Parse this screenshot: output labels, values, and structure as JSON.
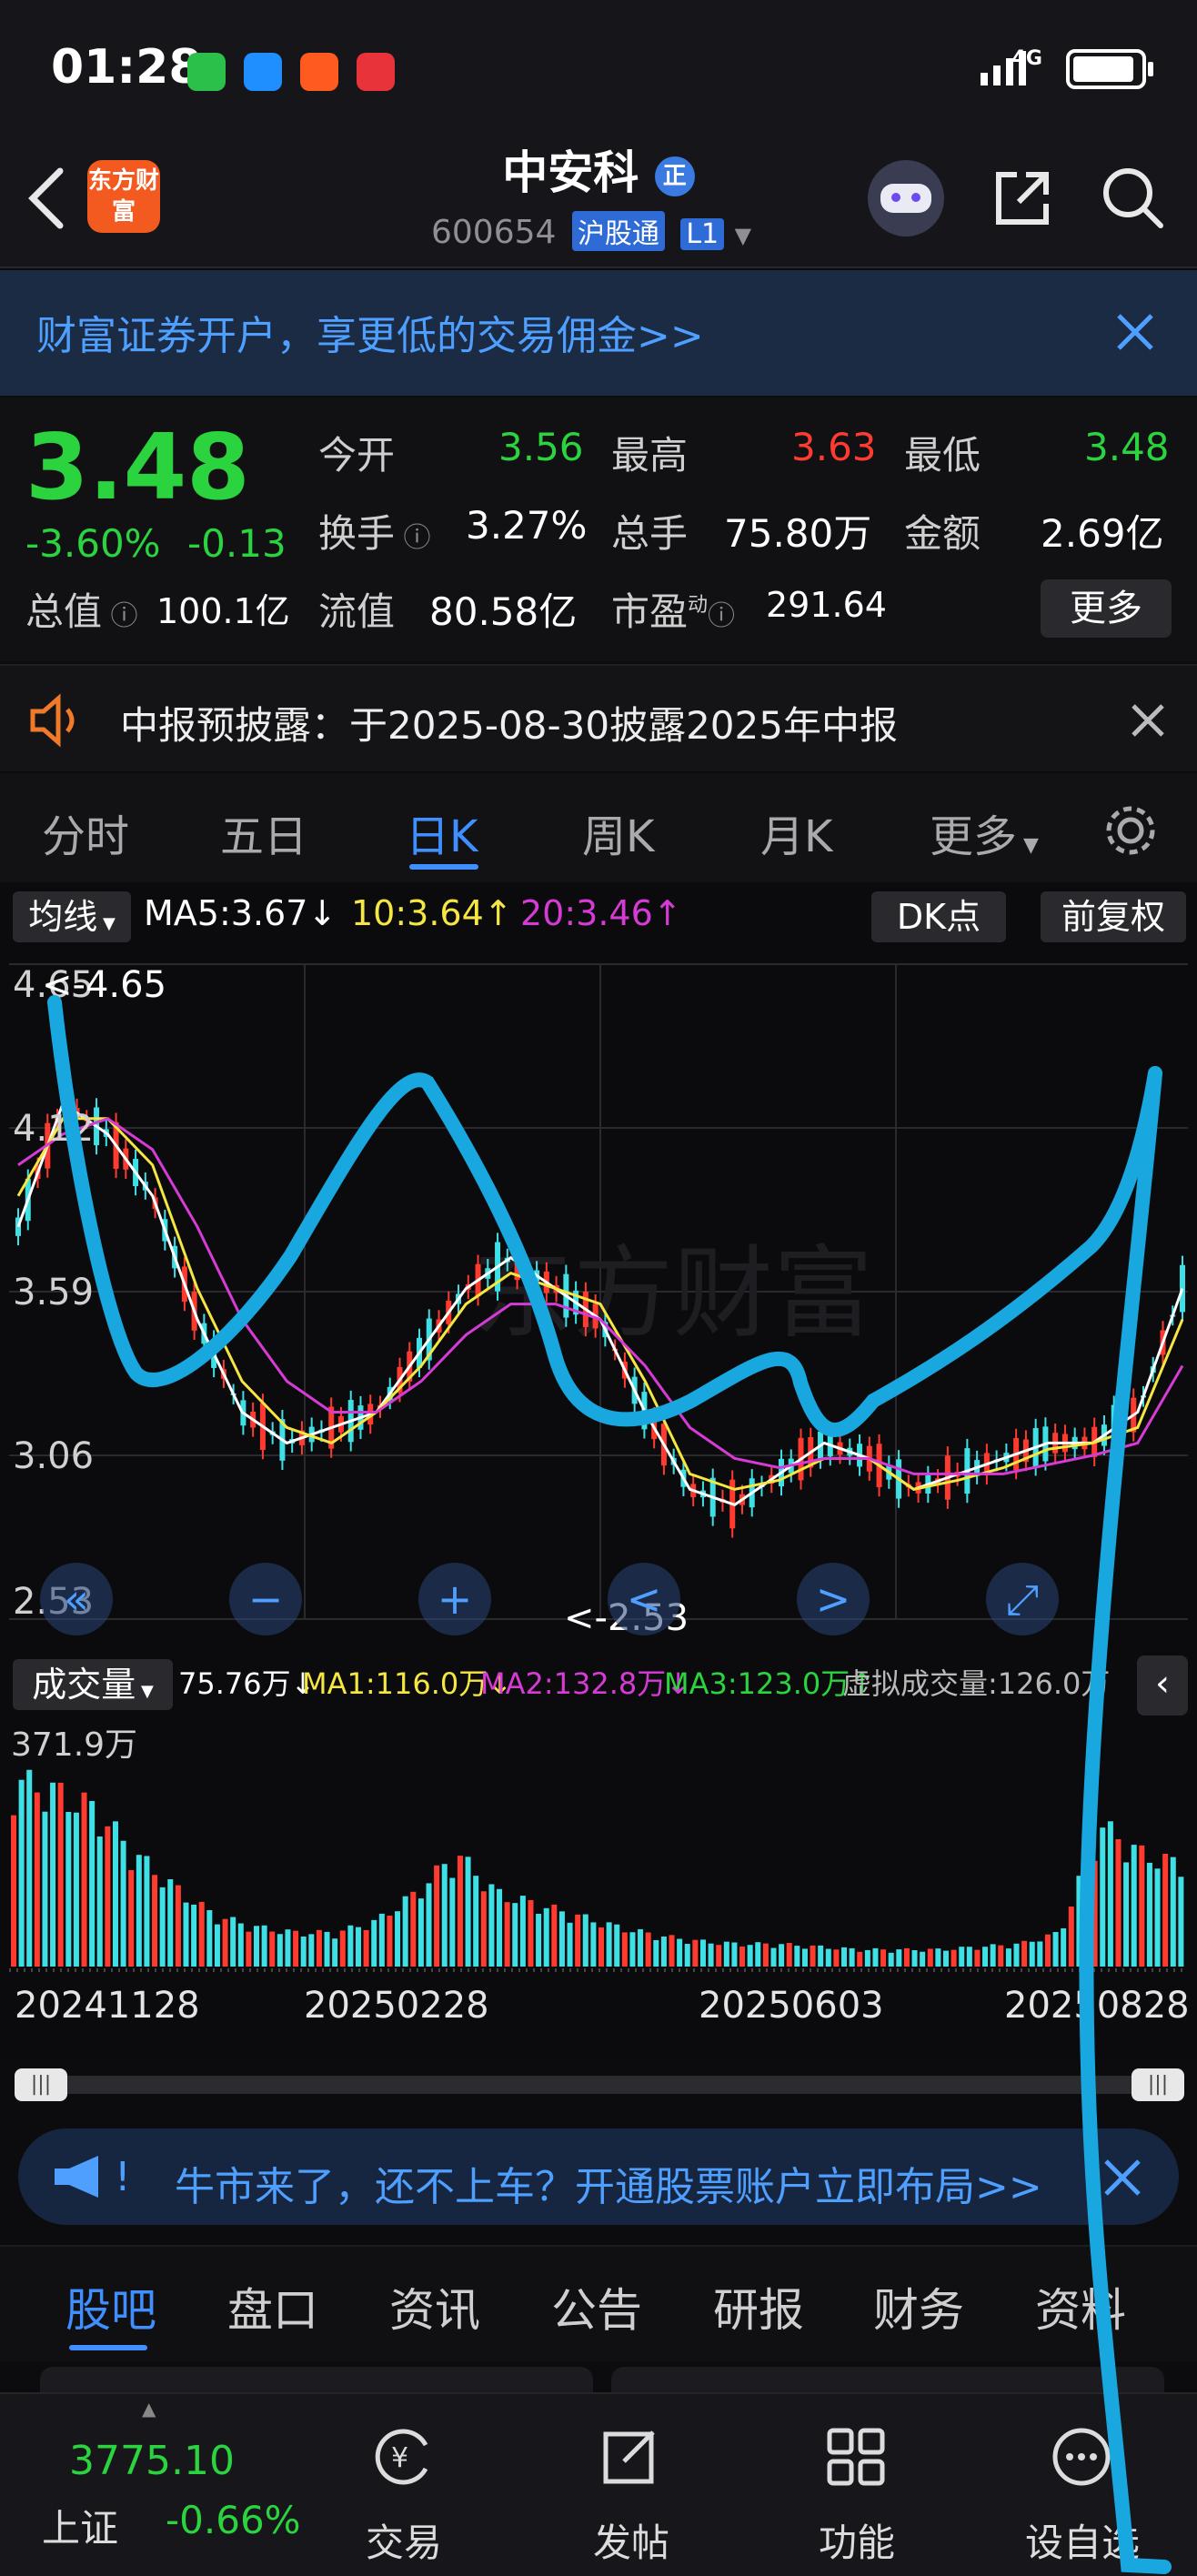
{
  "status_bar": {
    "time": "01:28",
    "network": "4G"
  },
  "header": {
    "back_label": "<",
    "broker_logo": "东方财富",
    "stock_name": "中安科",
    "stock_badge": "正",
    "code": "600654",
    "channel_tag": "沪股通",
    "level_tag": "L1"
  },
  "banner": {
    "text": "财富证券开户，享更低的交易佣金>>"
  },
  "quote": {
    "price": "3.48",
    "change_pct": "-3.60%",
    "change_abs": "-0.13",
    "open_label": "今开",
    "open_value": "3.56",
    "high_label": "最高",
    "high_value": "3.63",
    "low_label": "最低",
    "low_value": "3.48",
    "turnover_label": "换手",
    "turnover_value": "3.27%",
    "volume_label": "总手",
    "volume_value": "75.80万",
    "amount_label": "金额",
    "amount_value": "2.69亿",
    "mktcap_label": "总值",
    "mktcap_value": "100.1亿",
    "float_label": "流值",
    "float_value": "80.58亿",
    "pe_label": "市盈",
    "pe_sup": "动",
    "pe_value": "291.64",
    "more_button": "更多"
  },
  "notice": {
    "text": "中报预披露：于2025-08-30披露2025年中报"
  },
  "tabs": [
    "分时",
    "五日",
    "日K",
    "周K",
    "月K",
    "更多"
  ],
  "chart": {
    "ma_selector": "均线",
    "ma5": "MA5:3.67↓",
    "ma10": "10:3.64↑",
    "ma20": "20:3.46↑",
    "dk_button": "DK点",
    "adjust_button": "前复权",
    "watermark": "东方财富",
    "price_max_marker": "<-4.65",
    "price_min_marker": "<-2.53",
    "vol_selector": "成交量",
    "vol_value": "75.76万↓",
    "vol_ma1": "MA1:116.0万↓",
    "vol_ma2": "MA2:132.8万↓",
    "vol_ma3": "MA3:123.0万↑",
    "vol_virtual": "虚拟成交量:126.0万",
    "vol_max_label": "371.9万"
  },
  "chart_data": {
    "type": "candlestick",
    "y_ticks": [
      "4.65",
      "4.12",
      "3.59",
      "3.06",
      "2.53"
    ],
    "ylim": [
      2.53,
      4.65
    ],
    "x_ticks": [
      "20241128",
      "20250228",
      "20250603",
      "20250828"
    ],
    "series": [
      {
        "name": "MA5",
        "color": "#ffffff",
        "values": [
          3.8,
          4.2,
          4.1,
          3.9,
          3.5,
          3.2,
          3.1,
          3.15,
          3.2,
          3.4,
          3.6,
          3.7,
          3.6,
          3.5,
          3.2,
          2.95,
          2.9,
          3.0,
          3.1,
          3.05,
          2.95,
          3.0,
          3.05,
          3.1,
          3.1,
          3.2,
          3.6
        ]
      },
      {
        "name": "MA10",
        "color": "#f5e642",
        "values": [
          3.9,
          4.15,
          4.15,
          4.0,
          3.6,
          3.3,
          3.15,
          3.1,
          3.2,
          3.35,
          3.55,
          3.65,
          3.6,
          3.55,
          3.3,
          3.0,
          2.95,
          2.98,
          3.05,
          3.05,
          2.95,
          2.98,
          3.02,
          3.08,
          3.1,
          3.15,
          3.5
        ]
      },
      {
        "name": "MA20",
        "color": "#d63bd6",
        "values": [
          4.0,
          4.1,
          4.15,
          4.05,
          3.8,
          3.5,
          3.3,
          3.2,
          3.2,
          3.3,
          3.45,
          3.55,
          3.55,
          3.5,
          3.35,
          3.15,
          3.05,
          3.02,
          3.05,
          3.05,
          3.0,
          3.0,
          3.0,
          3.03,
          3.06,
          3.1,
          3.35
        ]
      }
    ],
    "volume_ylim": [
      0,
      371.9
    ],
    "volume_unit": "万",
    "volume_values": [
      330,
      310,
      280,
      200,
      140,
      90,
      70,
      60,
      60,
      80,
      130,
      200,
      130,
      110,
      90,
      70,
      55,
      45,
      40,
      40,
      35,
      30,
      30,
      30,
      35,
      40,
      60,
      250,
      200,
      180
    ]
  },
  "chart_controls": [
    "«",
    "−",
    "+",
    "<",
    ">",
    "⤢"
  ],
  "promo": {
    "text": "牛市来了，还不上车？开通股票账户立即布局>>"
  },
  "bottom_tabs": [
    "股吧",
    "盘口",
    "资讯",
    "公告",
    "研报",
    "财务",
    "资料"
  ],
  "nav": {
    "index_value": "3775.10",
    "index_name": "上证",
    "index_change": "-0.66%",
    "items": [
      "交易",
      "发帖",
      "功能",
      "设自选"
    ]
  }
}
